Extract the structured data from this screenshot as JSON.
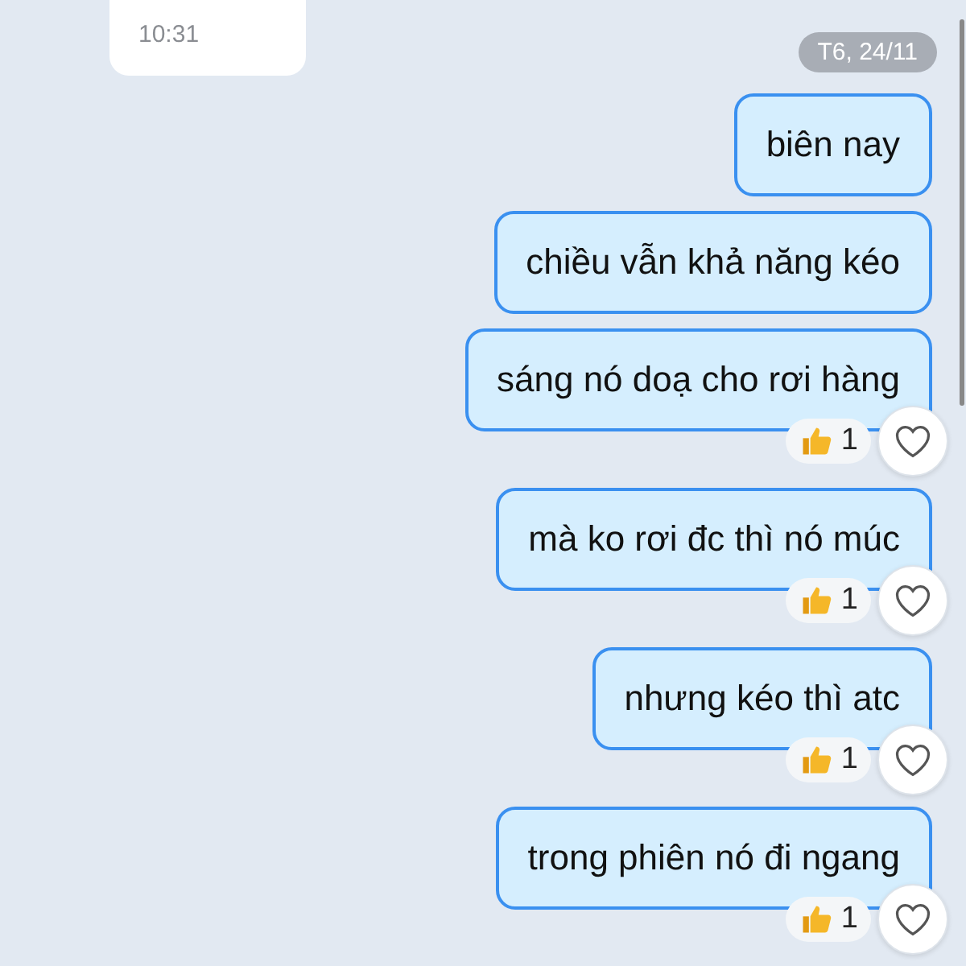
{
  "incoming_message": {
    "time": "10:31"
  },
  "date_separator": "T6, 24/11",
  "messages": [
    {
      "text": "biên nay"
    },
    {
      "text": "chiều vẫn khả năng kéo"
    },
    {
      "text": "sáng nó doạ cho rơi hàng",
      "reaction": {
        "count": "1"
      }
    },
    {
      "text": "mà ko rơi đc thì nó múc",
      "reaction": {
        "count": "1"
      }
    },
    {
      "text": "nhưng kéo thì atc",
      "reaction": {
        "count": "1"
      }
    },
    {
      "text": "trong phiên nó đi ngang",
      "reaction": {
        "count": "1"
      }
    }
  ]
}
